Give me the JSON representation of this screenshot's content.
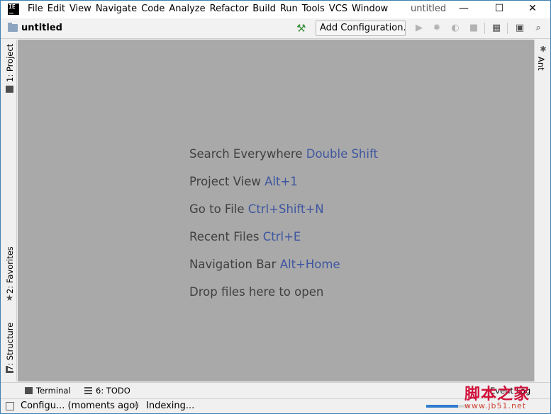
{
  "app": {
    "icon_text": "IE",
    "window_title": "untitled"
  },
  "menu": [
    "File",
    "Edit",
    "View",
    "Navigate",
    "Code",
    "Analyze",
    "Refactor",
    "Build",
    "Run",
    "Tools",
    "VCS",
    "Window"
  ],
  "window_controls": {
    "minimize": "—",
    "maximize": "☐",
    "close": "✕"
  },
  "navbar": {
    "project_name": "untitled",
    "add_configuration": "Add Configuration..."
  },
  "left_tabs": {
    "project": "1: Project",
    "favorites": "2: Favorites",
    "structure": "7: Structure"
  },
  "right_tabs": {
    "ant": "Ant"
  },
  "editor_hints": [
    {
      "text": "Search Everywhere",
      "key": "Double Shift"
    },
    {
      "text": "Project View",
      "key": "Alt+1"
    },
    {
      "text": "Go to File",
      "key": "Ctrl+Shift+N"
    },
    {
      "text": "Recent Files",
      "key": "Ctrl+E"
    },
    {
      "text": "Navigation Bar",
      "key": "Alt+Home"
    },
    {
      "text": "Drop files here to open",
      "key": ""
    }
  ],
  "bottom_tabs": {
    "terminal": "Terminal",
    "todo": "6: TODO",
    "event_log": "Event Log"
  },
  "status": {
    "message": "Configu... (moments ago)",
    "indexing": "Indexing...",
    "progress": 0.75
  },
  "watermark": {
    "main": "脚本之家",
    "sub": "www.jb51.net"
  },
  "colors": {
    "editor_bg": "#a9a9a9",
    "shortcut": "#3e56a0",
    "build_icon": "#3e8f3e",
    "watermark": "#d0123a"
  }
}
